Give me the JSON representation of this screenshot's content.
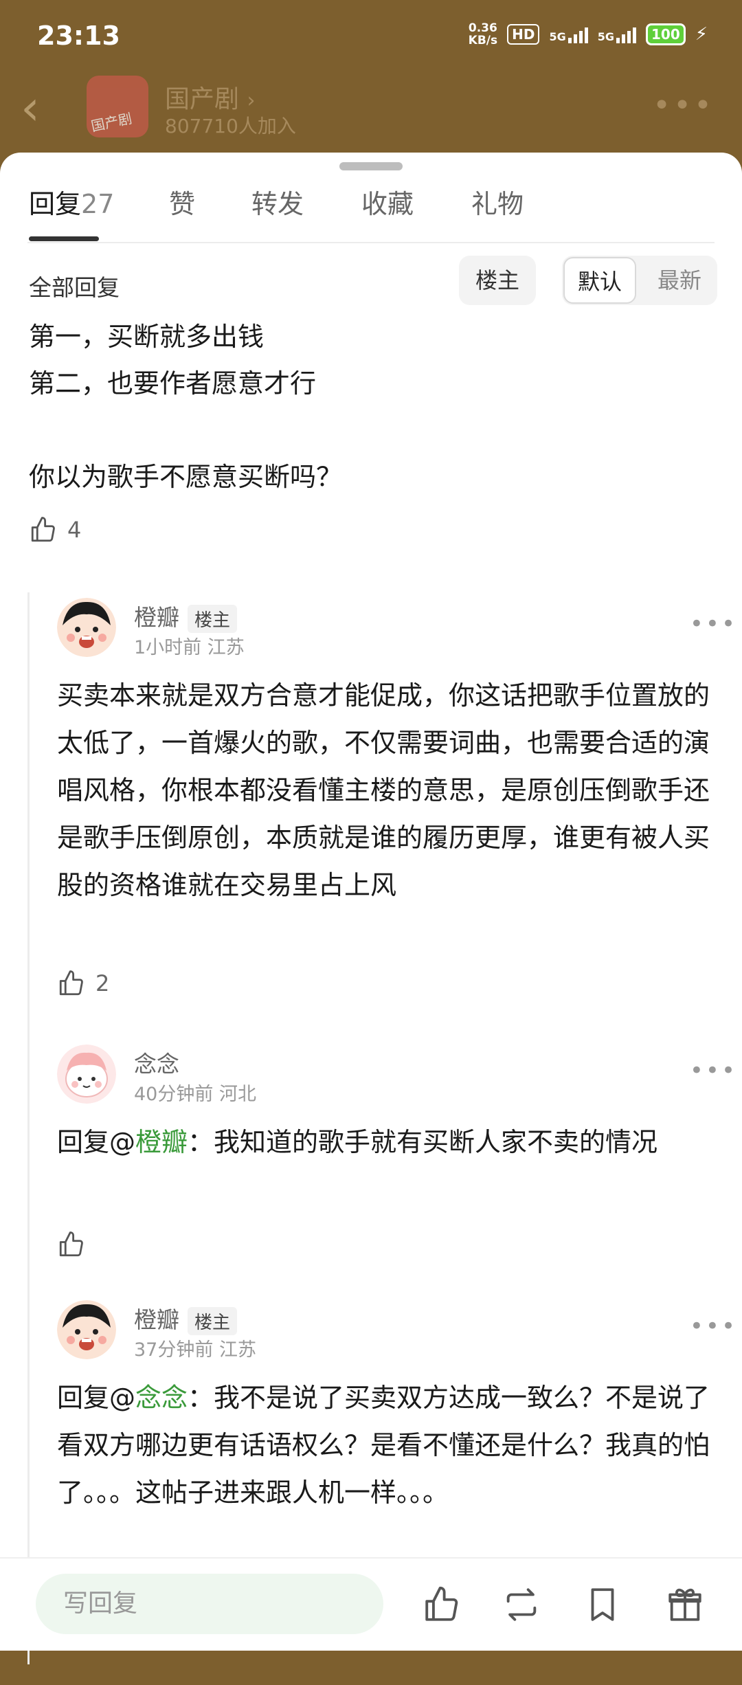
{
  "status_bar": {
    "time": "23:13",
    "net_speed_value": "0.36",
    "net_speed_unit": "KB/s",
    "hd": "HD",
    "sim1": "5G",
    "sim2": "5G",
    "battery": "100"
  },
  "header": {
    "group_name": "国产剧",
    "members": "807710人加入",
    "avatar_text": "国产剧"
  },
  "tabs": [
    {
      "label": "回复",
      "count": "27"
    },
    {
      "label": "赞"
    },
    {
      "label": "转发"
    },
    {
      "label": "收藏"
    },
    {
      "label": "礼物"
    }
  ],
  "filter": {
    "title": "全部回复",
    "owner_chip": "楼主",
    "sort_default": "默认",
    "sort_latest": "最新"
  },
  "main_comment": {
    "lines": [
      "第一，买断就多出钱",
      "第二，也要作者愿意才行",
      "",
      "你以为歌手不愿意买断吗？"
    ],
    "likes": "4"
  },
  "replies": [
    {
      "name": "橙瓣",
      "badge": "楼主",
      "meta": "1小时前 江苏",
      "mention_prefix": "",
      "mention": "",
      "text": "买卖本来就是双方合意才能促成，你这话把歌手位置放的太低了，一首爆火的歌，不仅需要词曲，也需要合适的演唱风格，你根本都没看懂主楼的意思，是原创压倒歌手还是歌手压倒原创，本质就是谁的履历更厚，谁更有被人买股的资格谁就在交易里占上风",
      "likes": "2"
    },
    {
      "name": "念念",
      "badge": "",
      "meta": "40分钟前 河北",
      "mention_prefix": "回复@",
      "mention": "橙瓣",
      "text": "：我知道的歌手就有买断人家不卖的情况",
      "likes": ""
    },
    {
      "name": "橙瓣",
      "badge": "楼主",
      "meta": "37分钟前 江苏",
      "mention_prefix": "回复@",
      "mention": "念念",
      "text": "：我不是说了买卖双方达成一致么？不是说了看双方哪边更有话语权么？是看不懂还是什么？我真的怕了。。。这帖子进来跟人机一样。。。",
      "likes": ""
    }
  ],
  "bottom_bar": {
    "reply_placeholder": "写回复",
    "icons": [
      "like-icon",
      "repost-icon",
      "bookmark-icon",
      "gift-icon"
    ]
  },
  "colors": {
    "header_dim": "#7d5f2e",
    "mention": "#3a9a3a",
    "reply_input_bg": "#eef7ef"
  }
}
